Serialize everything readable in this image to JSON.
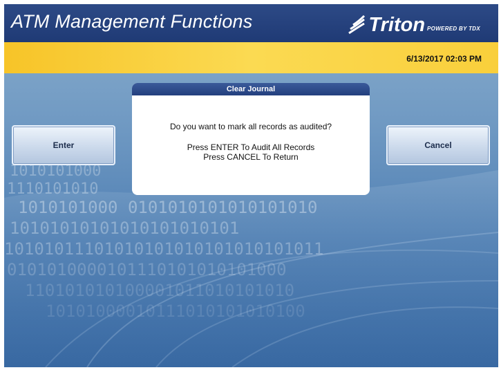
{
  "header": {
    "title": "ATM Management Functions",
    "brand_name": "Triton",
    "brand_tagline": "POWERED BY TDX"
  },
  "status": {
    "datetime": "6/13/2017  02:03 PM"
  },
  "buttons": {
    "enter_label": "Enter",
    "cancel_label": "Cancel"
  },
  "dialog": {
    "title": "Clear Journal",
    "question": "Do you want to mark all records as audited?",
    "instruction_enter": "Press ENTER To Audit All Records",
    "instruction_cancel": "Press CANCEL To Return"
  },
  "background_digits": [
    "1010101000",
    "1110101010",
    "1010101000  0101010101010101010",
    "10101010101010101010101",
    "10101011101010101010101010101011",
    "0101010000101110101010101000",
    "110101010100001011010101010",
    "10101000010111010101010100"
  ],
  "colors": {
    "titlebar": "#1f3a75",
    "statusbar": "#f9cf3b",
    "background": "#5a88bb",
    "dialog_header": "#2a4888"
  }
}
